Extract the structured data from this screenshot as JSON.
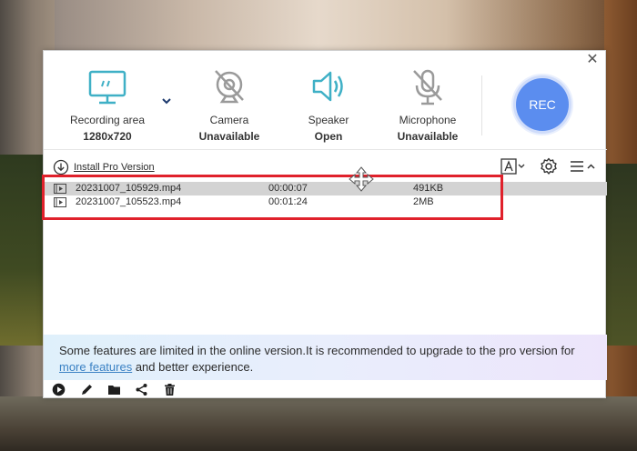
{
  "window": {
    "close_icon": "close-icon"
  },
  "sources": [
    {
      "name": "Recording area",
      "value": "1280x720",
      "icon": "monitor-icon"
    },
    {
      "name": "Camera",
      "value": "Unavailable",
      "icon": "camera-off-icon"
    },
    {
      "name": "Speaker",
      "value": "Open",
      "icon": "speaker-icon"
    },
    {
      "name": "Microphone",
      "value": "Unavailable",
      "icon": "microphone-off-icon"
    }
  ],
  "rec_label": "REC",
  "toolbar": {
    "install_label": "Install Pro Version",
    "icons": [
      "text-format-icon",
      "settings-icon",
      "menu-icon"
    ]
  },
  "files": [
    {
      "name": "20231007_105929.mp4",
      "duration": "00:00:07",
      "size": "491KB",
      "selected": true
    },
    {
      "name": "20231007_105523.mp4",
      "duration": "00:01:24",
      "size": "2MB",
      "selected": false
    }
  ],
  "notice": {
    "text_before": "Some features are limited in the online version.It is recommended to upgrade to the pro version for",
    "link": "more features",
    "text_after": " and better experience."
  },
  "bottom_icons": [
    "play-icon",
    "edit-icon",
    "folder-icon",
    "share-icon",
    "delete-icon"
  ],
  "colors": {
    "accent": "#5b8def",
    "icon_teal": "#3fb0c6",
    "highlight": "#e0212b"
  }
}
